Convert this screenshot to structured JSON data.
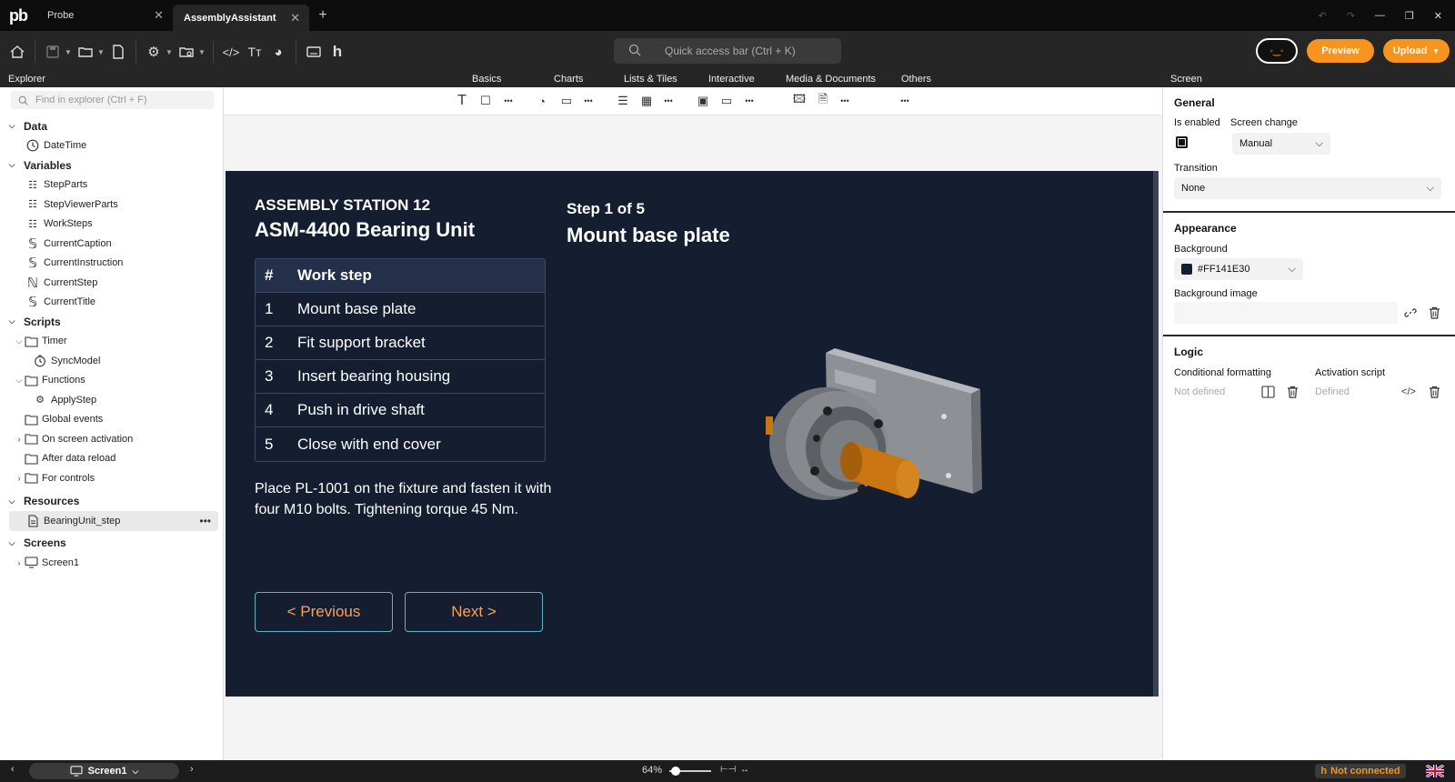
{
  "app": {
    "logo": "pb"
  },
  "tabs": [
    {
      "label": "Probe",
      "active": false
    },
    {
      "label": "AssemblyAssistant",
      "active": true
    }
  ],
  "toolbar": {
    "quick_access": "Quick access bar (Ctrl + K)",
    "preview": "Preview",
    "upload": "Upload",
    "accent_color": "#F7941D"
  },
  "sections": {
    "explorer": "Explorer",
    "screen": "Screen",
    "categories": [
      "Basics",
      "Charts",
      "Lists & Tiles",
      "Interactive",
      "Media & Documents",
      "Others"
    ]
  },
  "explorer": {
    "search_placeholder": "Find in explorer (Ctrl + F)",
    "data_header": "Data",
    "data_items": [
      "DateTime"
    ],
    "variables_header": "Variables",
    "variables": [
      {
        "label": "StepParts",
        "icon": "list-icon"
      },
      {
        "label": "StepViewerParts",
        "icon": "list-icon"
      },
      {
        "label": "WorkSteps",
        "icon": "list-icon"
      },
      {
        "label": "CurrentCaption",
        "icon": "string-icon"
      },
      {
        "label": "CurrentInstruction",
        "icon": "string-icon"
      },
      {
        "label": "CurrentStep",
        "icon": "number-icon"
      },
      {
        "label": "CurrentTitle",
        "icon": "string-icon"
      }
    ],
    "scripts_header": "Scripts",
    "scripts": {
      "timer": "Timer",
      "sync_model": "SyncModel",
      "functions": "Functions",
      "apply_step": "ApplyStep",
      "global_events": "Global events",
      "on_screen_activation": "On screen activation",
      "after_data_reload": "After data reload",
      "for_controls": "For controls"
    },
    "resources_header": "Resources",
    "resources": [
      "BearingUnit_step"
    ],
    "screens_header": "Screens",
    "screens": [
      "Screen1"
    ]
  },
  "stage": {
    "background": "#141E30",
    "station": "ASSEMBLY STATION 12",
    "product": "ASM-4400 Bearing Unit",
    "step_indicator": "Step 1 of 5",
    "step_title": "Mount base plate",
    "table_headers": [
      "#",
      "Work step"
    ],
    "work_steps": [
      {
        "num": "1",
        "label": "Mount base plate"
      },
      {
        "num": "2",
        "label": "Fit support bracket"
      },
      {
        "num": "3",
        "label": "Insert bearing housing"
      },
      {
        "num": "4",
        "label": "Push in drive shaft"
      },
      {
        "num": "5",
        "label": "Close with end cover"
      }
    ],
    "instruction": "Place PL-1001 on the fixture and fasten it with four M10 bolts. Tightening torque 45 Nm.",
    "prev_button": "< Previous",
    "next_button": "Next >"
  },
  "properties": {
    "general_header": "General",
    "is_enabled_label": "Is enabled",
    "is_enabled": true,
    "screen_change_label": "Screen change",
    "screen_change_value": "Manual",
    "transition_label": "Transition",
    "transition_value": "None",
    "appearance_header": "Appearance",
    "background_label": "Background",
    "background_value": "#FF141E30",
    "background_swatch": "#141E30",
    "background_image_label": "Background image",
    "logic_header": "Logic",
    "conditional_formatting_label": "Conditional formatting",
    "conditional_formatting_value": "Not defined",
    "activation_script_label": "Activation script",
    "activation_script_value": "Defined"
  },
  "statusbar": {
    "screen": "Screen1",
    "zoom": "64%",
    "connection": "Not connected"
  }
}
